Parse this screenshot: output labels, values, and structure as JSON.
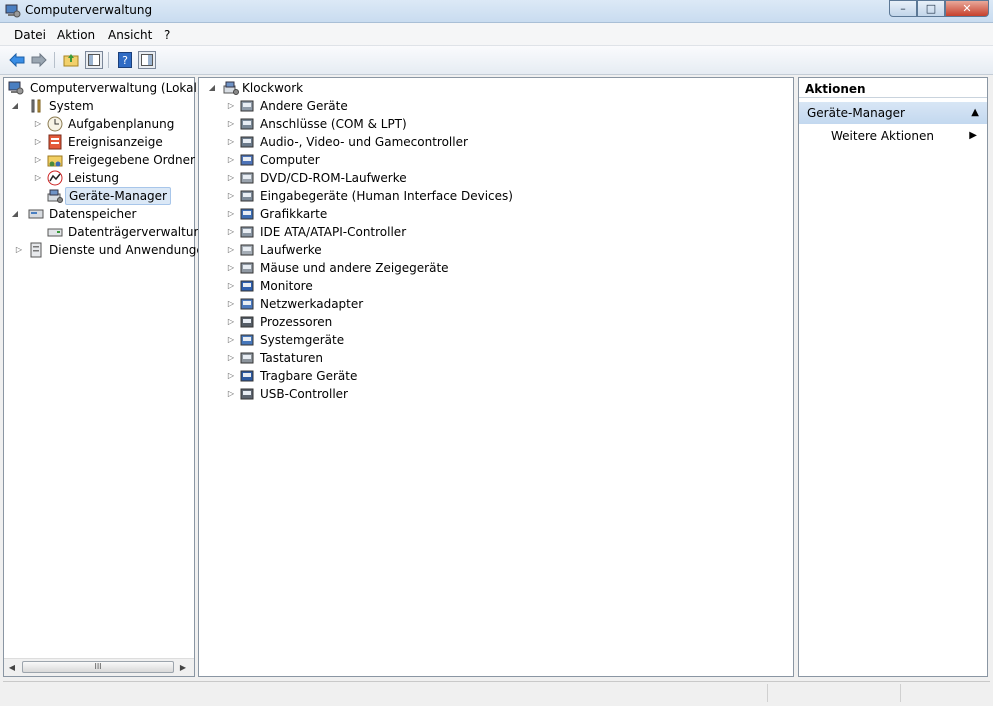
{
  "window": {
    "title": "Computerverwaltung",
    "controls": {
      "minimize": "–",
      "maximize": "□",
      "close": "✕"
    }
  },
  "menu": [
    "Datei",
    "Aktion",
    "Ansicht",
    "?"
  ],
  "nav_tree": {
    "root": "Computerverwaltung (Lokal)",
    "system": {
      "label": "System",
      "children": [
        "Aufgabenplanung",
        "Ereignisanzeige",
        "Freigegebene Ordner",
        "Leistung",
        "Geräte-Manager"
      ]
    },
    "storage": {
      "label": "Datenspeicher",
      "children": [
        "Datenträgerverwaltung"
      ]
    },
    "services": {
      "label": "Dienste und Anwendungen"
    },
    "selected": "Geräte-Manager"
  },
  "device_tree": {
    "computer_name": "Klockwork",
    "categories": [
      "Andere Geräte",
      "Anschlüsse (COM & LPT)",
      "Audio-, Video- und Gamecontroller",
      "Computer",
      "DVD/CD-ROM-Laufwerke",
      "Eingabegeräte (Human Interface Devices)",
      "Grafikkarte",
      "IDE ATA/ATAPI-Controller",
      "Laufwerke",
      "Mäuse und andere Zeigegeräte",
      "Monitore",
      "Netzwerkadapter",
      "Prozessoren",
      "Systemgeräte",
      "Tastaturen",
      "Tragbare Geräte",
      "USB-Controller"
    ]
  },
  "actions_pane": {
    "header": "Aktionen",
    "section": "Geräte-Manager",
    "items": [
      "Weitere Aktionen"
    ]
  },
  "scrollbar": {
    "thumb_grip": "III"
  },
  "colors": {
    "accent": "#1e5fb4",
    "selection": "#dbe8f6",
    "section": "#c9dcf0"
  }
}
